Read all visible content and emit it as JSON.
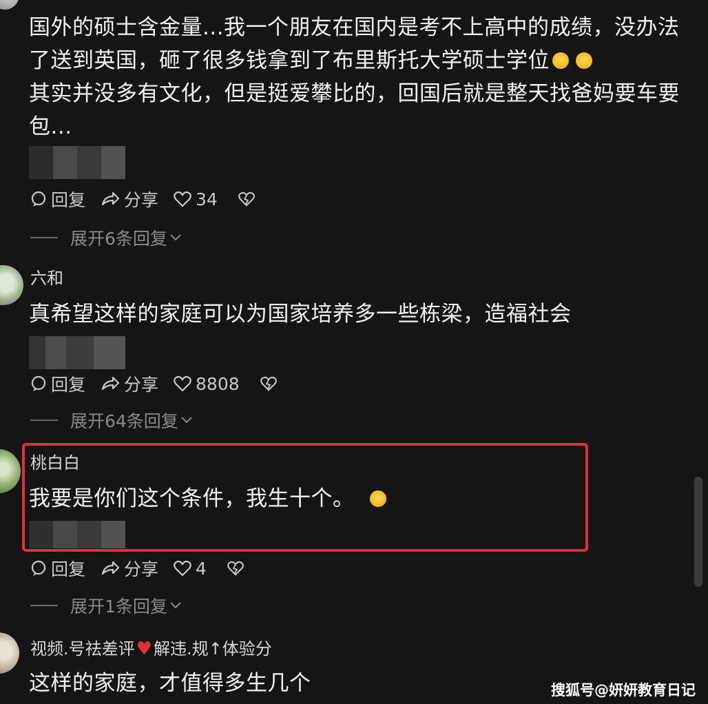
{
  "comments": [
    {
      "username": "",
      "text": "国外的硕士含金量...我一个朋友在国内是考不上高中的成绩，没办法了送到英国，砸了很多钱拿到了布里斯托大学硕士学位",
      "text_tail": "其实并没多有文化，但是挺爱攀比的，回国后就是整天找爸妈要车要包...",
      "emoji": [
        "cat-face",
        "cat-face"
      ],
      "actions": {
        "reply": "回复",
        "share": "分享",
        "likes": "34"
      },
      "expand": "展开6条回复"
    },
    {
      "username": "六和",
      "text": "真希望这样的家庭可以为国家培养多一些栋梁，造福社会",
      "actions": {
        "reply": "回复",
        "share": "分享",
        "likes": "8808"
      },
      "expand": "展开64条回复"
    },
    {
      "username": "桃白白",
      "text": "我要是你们这个条件，我生十个。",
      "emoji": [
        "smile"
      ],
      "actions": {
        "reply": "回复",
        "share": "分享",
        "likes": "4"
      },
      "expand": "展开1条回复"
    },
    {
      "username_a": "视频.号祛差评",
      "username_b": "解违.规",
      "username_c": "体验分",
      "text": "这样的家庭，才值得多生几个"
    }
  ],
  "watermark": "搜狐号@妍妍教育日记",
  "colors": {
    "background": "#151515",
    "highlight_box": "#e0303a",
    "text": "#f2f2f2",
    "muted": "#8a8a8a"
  },
  "icons": [
    "comment-bubble-icon",
    "share-arrow-icon",
    "heart-icon",
    "dislike-heart-icon"
  ]
}
